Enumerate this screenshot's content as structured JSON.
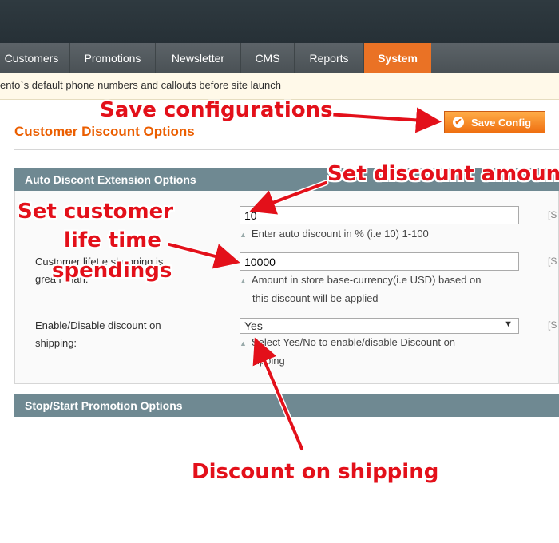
{
  "nav": {
    "items": [
      "Customers",
      "Promotions",
      "Newsletter",
      "CMS",
      "Reports",
      "System"
    ]
  },
  "notice": {
    "text": "ento`s default phone numbers and callouts before site launch"
  },
  "page": {
    "title": "Customer Discount Options",
    "save_label": "Save Config"
  },
  "sections": {
    "auto": "Auto Discont Extension Options",
    "promo": "Stop/Start Promotion Options"
  },
  "fields": {
    "discount": {
      "value": "10",
      "note": "Enter auto discount in % (i.e 10) 1-100",
      "scope": "[S"
    },
    "lifetime": {
      "label_line1": "Customer lifet   e shopping is",
      "label_line2": "grea   r than:",
      "value": "10000",
      "note_line1": "Amount in store base-currency(i.e USD) based on",
      "note_line2": "this discount will be applied",
      "scope": "[S"
    },
    "shipping": {
      "label_line1": "Enable/Disable discount on",
      "label_line2": "shipping:",
      "selected": "Yes",
      "note_line1": "Select Yes/No to enable/disable Discount on",
      "note_line2": "ipping",
      "scope": "[S"
    }
  },
  "annotations": {
    "save": "Save configurations",
    "amount": "Set discount amount",
    "lifetime_1": "Set customer",
    "lifetime_2": "life time",
    "lifetime_3": "spendings",
    "shipping": "Discount on shipping"
  },
  "colors": {
    "accent": "#ea7225",
    "annotation": "#e3101a",
    "section": "#6f8992"
  }
}
